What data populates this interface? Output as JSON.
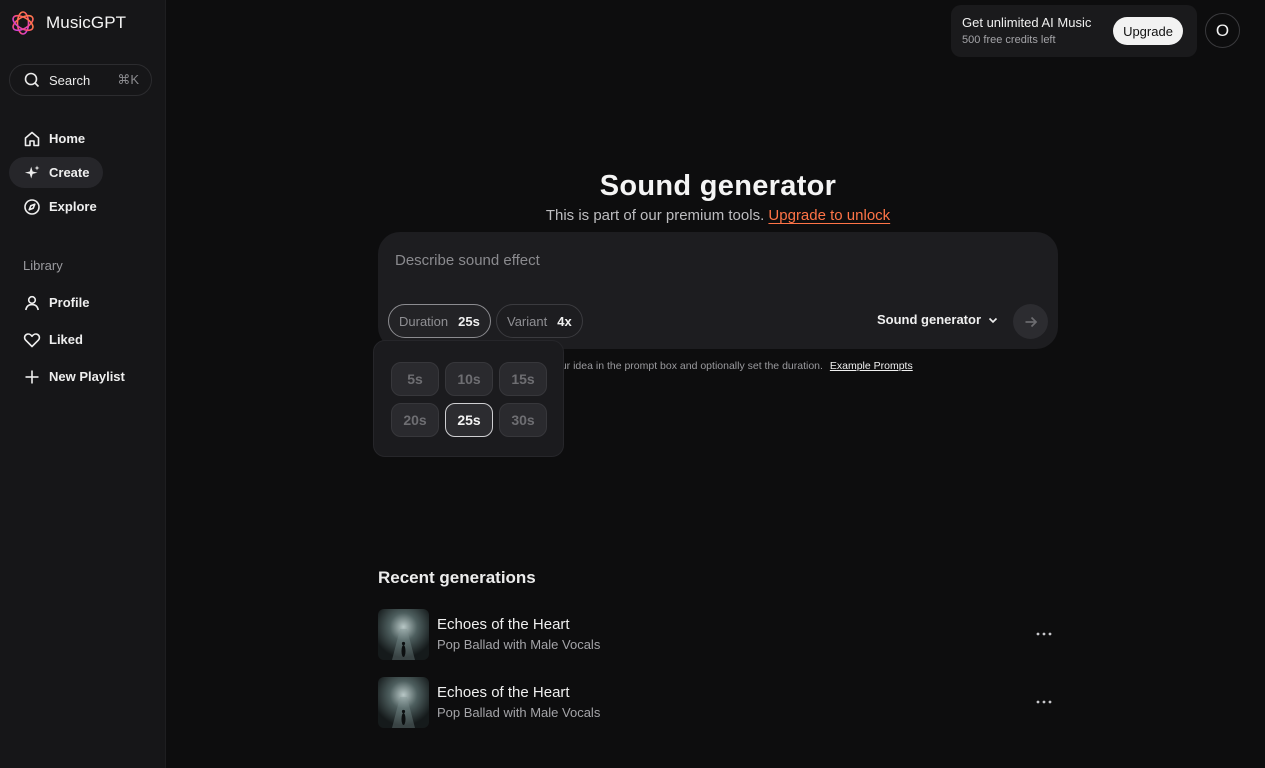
{
  "brand": {
    "name": "MusicGPT",
    "logo_icon": "flower-logo-icon"
  },
  "sidebar": {
    "search_label": "Search",
    "search_shortcut": "⌘K",
    "nav": [
      {
        "label": "Home",
        "icon": "home-icon",
        "active": false
      },
      {
        "label": "Create",
        "icon": "sparkle-icon",
        "active": true
      },
      {
        "label": "Explore",
        "icon": "compass-icon",
        "active": false
      }
    ],
    "library_label": "Library",
    "library": [
      {
        "label": "Profile",
        "icon": "user-icon"
      },
      {
        "label": "Liked",
        "icon": "heart-icon"
      },
      {
        "label": "New Playlist",
        "icon": "plus-icon"
      }
    ]
  },
  "promo": {
    "title": "Get unlimited AI Music",
    "subtitle": "500 free credits left",
    "button": "Upgrade"
  },
  "user": {
    "avatar_initial": "O"
  },
  "main": {
    "title": "Sound generator",
    "subtitle_prefix": "This is part of our premium tools.",
    "subtitle_link": "Upgrade to unlock",
    "prompt_placeholder": "Describe sound effect",
    "duration_label": "Duration",
    "duration_value": "25s",
    "variant_label": "Variant",
    "variant_value": "4x",
    "model_label": "Sound generator",
    "hint_text": "our idea in the prompt box and optionally set the duration.",
    "hint_link": "Example Prompts"
  },
  "duration_options": [
    "5s",
    "10s",
    "15s",
    "20s",
    "25s",
    "30s"
  ],
  "duration_selected": "25s",
  "recent": {
    "title": "Recent generations",
    "items": [
      {
        "title": "Echoes of the Heart",
        "subtitle": "Pop Ballad with Male Vocals"
      },
      {
        "title": "Echoes of the Heart",
        "subtitle": "Pop Ballad with Male Vocals"
      }
    ]
  },
  "colors": {
    "background": "#0d0d0e",
    "sidebar": "#161618",
    "accent": "#ff7447",
    "card": "#1d1d20"
  }
}
